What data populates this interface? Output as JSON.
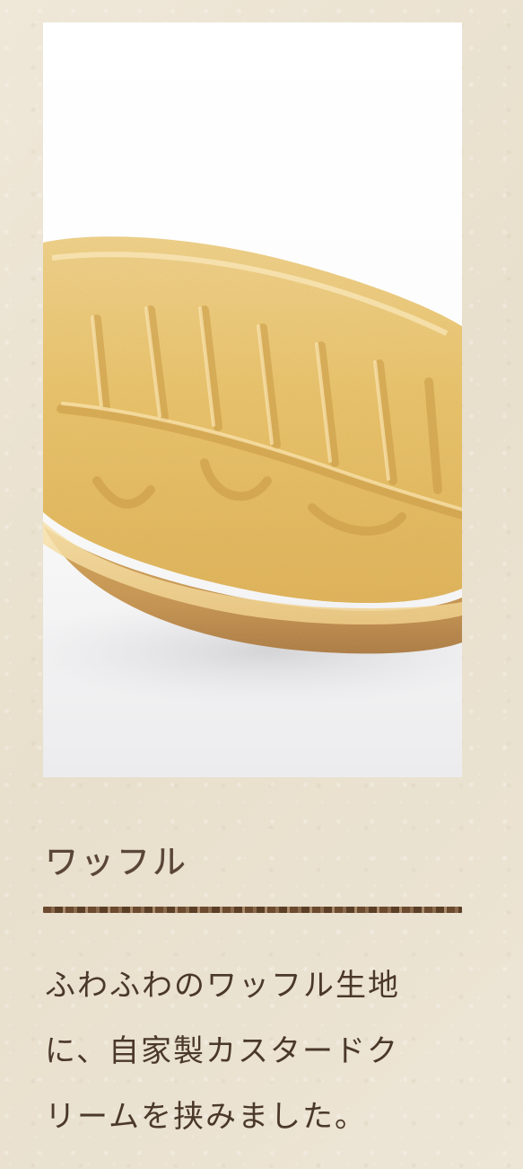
{
  "product": {
    "name": "ワッフル",
    "description_lines": [
      "ふわふわのワッフル生地",
      "に、自家製カスタードク",
      "リームを挟みました。"
    ],
    "image_alt": "ワッフル",
    "colors": {
      "background": "#ece3d2",
      "title_text": "#5a4637",
      "body_text": "#4a382b",
      "divider": "#6b4a2f",
      "waffle": "#e9c064"
    }
  }
}
